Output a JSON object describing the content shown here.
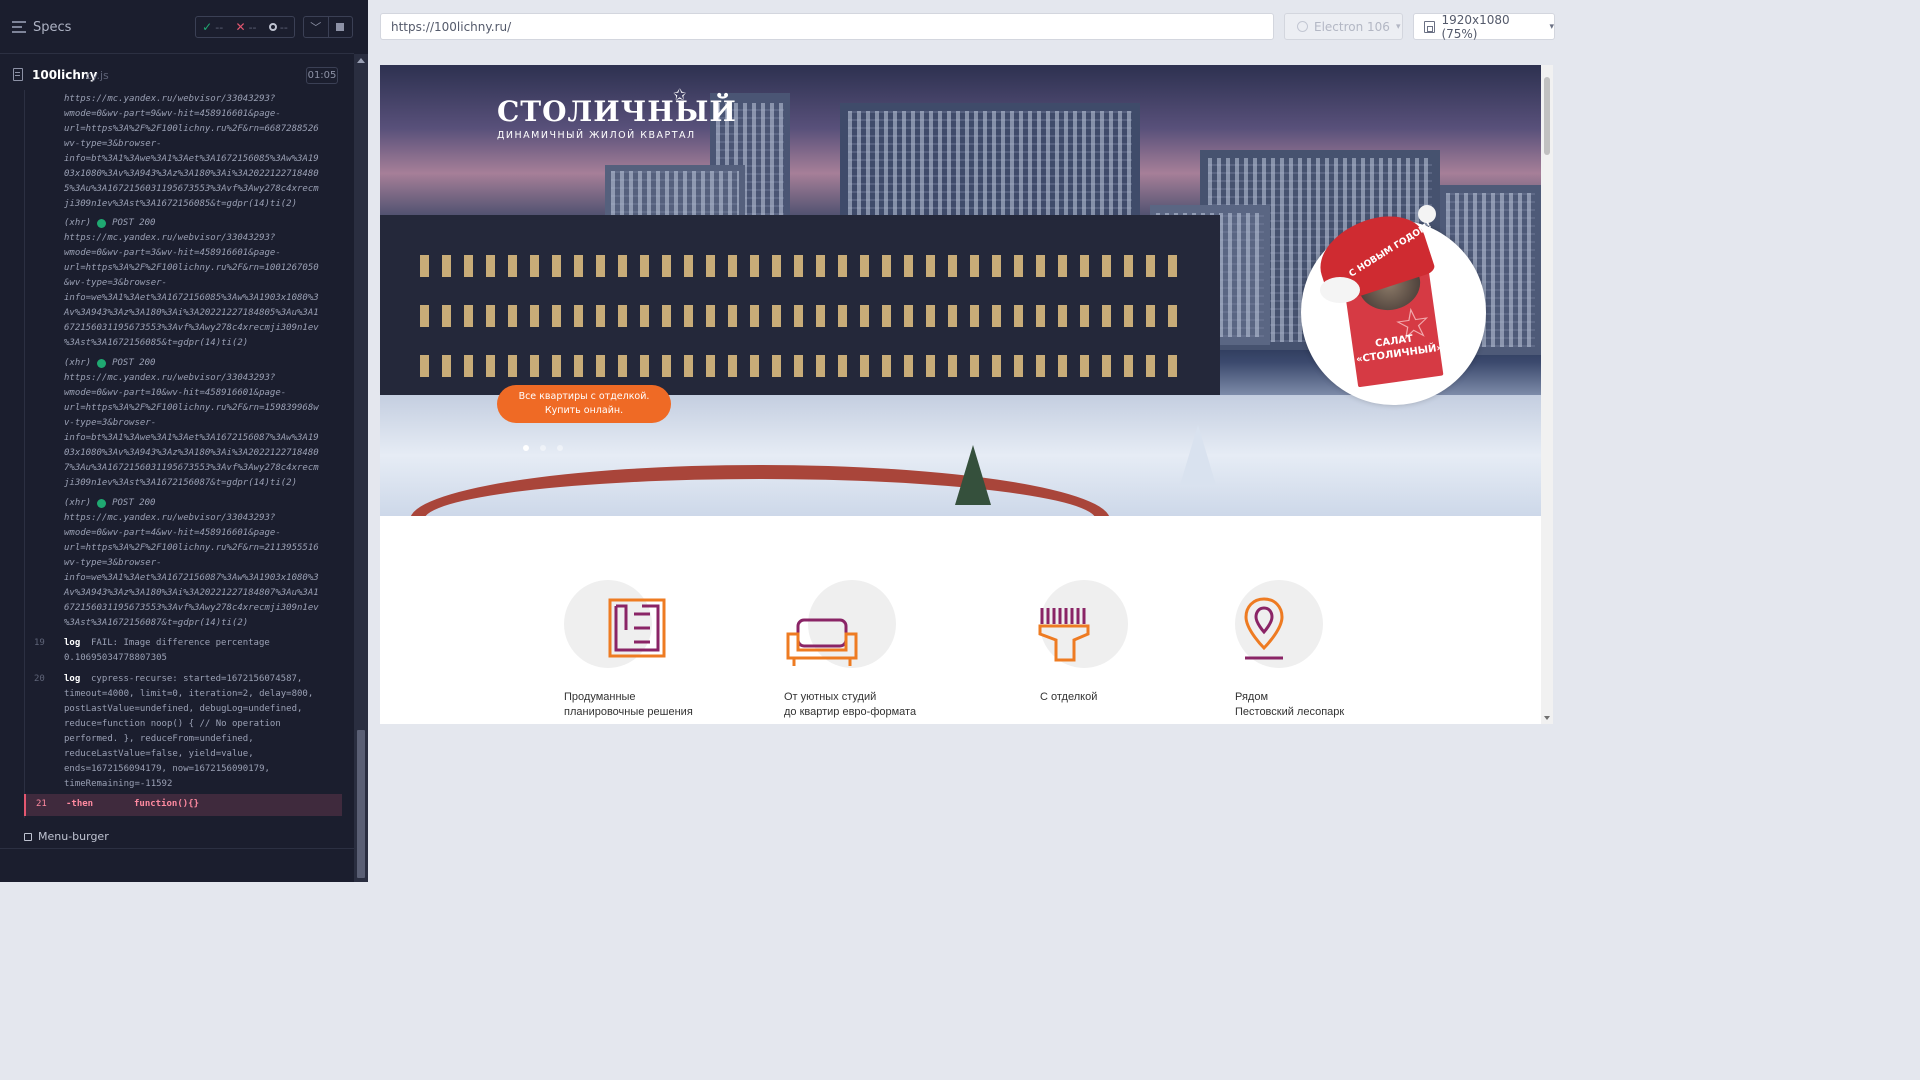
{
  "runner": {
    "specs_label": "Specs",
    "stats": {
      "passed": "--",
      "failed": "--",
      "pending": "--"
    },
    "file": {
      "name": "100lichny",
      "ext": ".cy.js",
      "duration": "01:05"
    },
    "log": {
      "partial_url": "https://mc.yandex.ru/webvisor/33043293?\nwmode=0&wv-part=9&wv-hit=458916601&page-\nurl=https%3A%2F%2F100lichny.ru%2F&rn=6687288526\nwv-type=3&browser-\ninfo=bt%3A1%3Awe%3A1%3Aet%3A1672156085%3Aw%3A19\n03x1080%3Av%3A943%3Az%3A180%3Ai%3A2022122718480\n5%3Au%3A1672156031195673553%3Avf%3Awy278c4xrecm\nji309n1ev%3Ast%3A1672156085&t=gdpr(14)ti(2)",
      "xhr": [
        {
          "type": "(xhr)",
          "status": "POST 200",
          "url": "https://mc.yandex.ru/webvisor/33043293?\nwmode=0&wv-part=3&wv-hit=458916601&page-\nurl=https%3A%2F%2F100lichny.ru%2F&rn=1001267050\n&wv-type=3&browser-\ninfo=we%3A1%3Aet%3A1672156085%3Aw%3A1903x1080%3\nAv%3A943%3Az%3A180%3Ai%3A20221227184805%3Au%3A1\n672156031195673553%3Avf%3Awy278c4xrecmji309n1ev\n%3Ast%3A1672156085&t=gdpr(14)ti(2)"
        },
        {
          "type": "(xhr)",
          "status": "POST 200",
          "url": "https://mc.yandex.ru/webvisor/33043293?\nwmode=0&wv-part=10&wv-hit=458916601&page-\nurl=https%3A%2F%2F100lichny.ru%2F&rn=159839968w\nv-type=3&browser-\ninfo=bt%3A1%3Awe%3A1%3Aet%3A1672156087%3Aw%3A19\n03x1080%3Av%3A943%3Az%3A180%3Ai%3A2022122718480\n7%3Au%3A1672156031195673553%3Avf%3Awy278c4xrecm\nji309n1ev%3Ast%3A1672156087&t=gdpr(14)ti(2)"
        },
        {
          "type": "(xhr)",
          "status": "POST 200",
          "url": "https://mc.yandex.ru/webvisor/33043293?\nwmode=0&wv-part=4&wv-hit=458916601&page-\nurl=https%3A%2F%2F100lichny.ru%2F&rn=2113955516\nwv-type=3&browser-\ninfo=we%3A1%3Aet%3A1672156087%3Aw%3A1903x1080%3\nAv%3A943%3Az%3A180%3Ai%3A20221227184807%3Au%3A1\n672156031195673553%3Avf%3Awy278c4xrecmji309n1ev\n%3Ast%3A1672156087&t=gdpr(14)ti(2)"
        }
      ],
      "cmd19": {
        "num": "19",
        "kw": "log",
        "msg": "FAIL: Image difference percentage\n0.10695034778807305"
      },
      "cmd20": {
        "num": "20",
        "kw": "log",
        "msg": "cypress-recurse: started=1672156074587,\ntimeout=4000, limit=0, iteration=2, delay=800,\npostLastValue=undefined, debugLog=undefined,\nreduce=function noop() { // No operation\nperformed. }, reduceFrom=undefined,\nreduceLastValue=false, yield=value,\nends=1672156094179, now=1672156090179,\ntimeRemaining=-11592"
      },
      "cmd21": {
        "num": "21",
        "kw": "-then",
        "msg": "function(){}"
      }
    },
    "test_title": "Menu-burger"
  },
  "browser": {
    "url": "https://100lichny.ru/",
    "engine": "Electron 106",
    "viewport": "1920x1080  (75%)"
  },
  "site": {
    "logo_title": "СТОЛИЧНЫЙ",
    "logo_subtitle": "ДИНАМИЧНЫЙ ЖИЛОЙ КВАРТАЛ",
    "cta_line1": "Все квартиры с отделкой.",
    "cta_line2": "Купить онлайн.",
    "promo_title": "САЛАТ «СТОЛИЧНЫЙ»",
    "promo_hat": "С НОВЫМ ГОДОМ!",
    "features": [
      {
        "line1": "Продуманные",
        "line2": "планировочные решения",
        "icon": "floorplan-icon"
      },
      {
        "line1": "От уютных студий",
        "line2": "до квартир евро-формата",
        "icon": "sofa-icon"
      },
      {
        "line1": "С отделкой",
        "line2": "",
        "icon": "paint-brush-icon"
      },
      {
        "line1": "Рядом",
        "line2": "Пестовский лесопарк",
        "icon": "map-pin-icon"
      }
    ]
  },
  "colors": {
    "runner_bg": "#1b1e2e",
    "pass": "#1fa971",
    "fail": "#e45770",
    "cta": "#ef6a25",
    "icon_orange": "#ee7b22",
    "icon_purple": "#8a2466"
  }
}
